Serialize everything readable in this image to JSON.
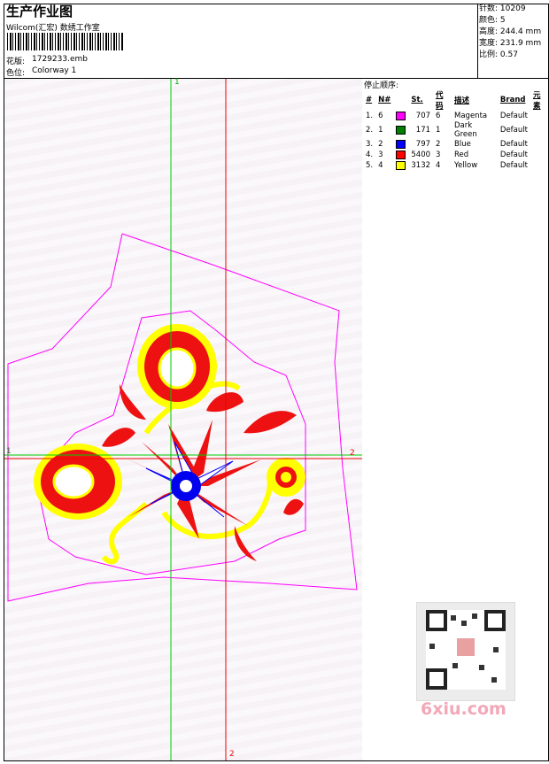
{
  "header": {
    "title": "生产作业图",
    "company": "Wilcom(汇宏) 数绣工作室",
    "pattern_label": "花版:",
    "pattern_file": "1729233.emb",
    "colorway_label": "色位:",
    "colorway": "Colorway 1"
  },
  "stats": [
    {
      "label": "针数:",
      "value": "10209"
    },
    {
      "label": "颜色:",
      "value": "5"
    },
    {
      "label": "高度:",
      "value": "244.4 mm"
    },
    {
      "label": "宽度:",
      "value": "231.9 mm"
    },
    {
      "label": "比例:",
      "value": "0.57"
    }
  ],
  "stop_sequence": {
    "title": "停止顺序:",
    "headers": [
      "#",
      "N#",
      "St.",
      "代码",
      "描述",
      "Brand",
      "元素"
    ],
    "rows": [
      {
        "idx": "1.",
        "n": "6",
        "color": "#ff00ff",
        "st": "707",
        "code": "6",
        "desc": "Magenta",
        "brand": "Default"
      },
      {
        "idx": "2.",
        "n": "1",
        "color": "#008000",
        "st": "171",
        "code": "1",
        "desc": "Dark Green",
        "brand": "Default"
      },
      {
        "idx": "3.",
        "n": "2",
        "color": "#0000ff",
        "st": "797",
        "code": "2",
        "desc": "Blue",
        "brand": "Default"
      },
      {
        "idx": "4.",
        "n": "3",
        "color": "#ff0000",
        "st": "5400",
        "code": "3",
        "desc": "Red",
        "brand": "Default"
      },
      {
        "idx": "5.",
        "n": "4",
        "color": "#ffff00",
        "st": "3132",
        "code": "4",
        "desc": "Yellow",
        "brand": "Default"
      }
    ]
  },
  "axes": {
    "v1": "1",
    "h2": "2",
    "v2": "2",
    "h1": "1"
  },
  "watermark": "6xiu.com"
}
